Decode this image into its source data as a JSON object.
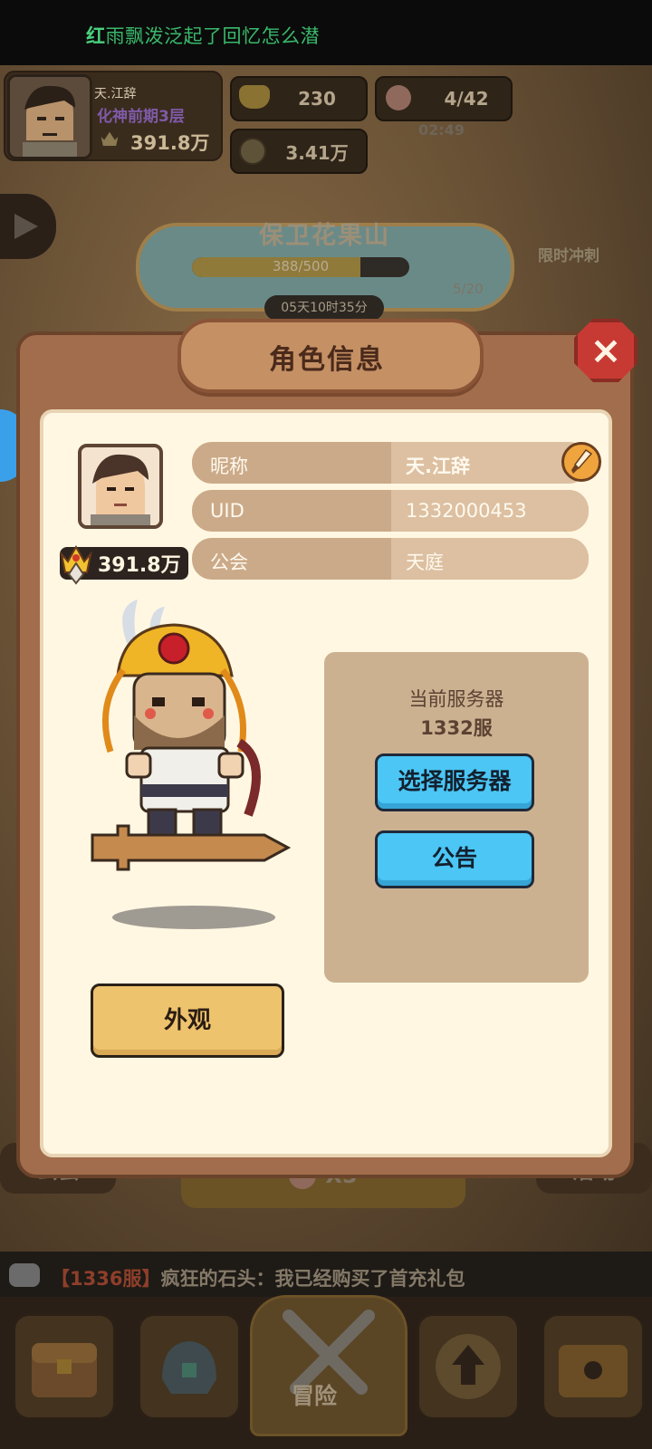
{
  "marquee": {
    "first_char": "红",
    "rest": "雨飘泼泛起了回忆怎么潜"
  },
  "player": {
    "name": "天.江辞",
    "rank": "化神前期3层",
    "power": "391.8万"
  },
  "resources": {
    "gold": "230",
    "peach_energy": "4/42",
    "energy_timer": "02:49",
    "coins": "3.41万"
  },
  "event": {
    "title": "保卫花果山",
    "progress_text": "388/500",
    "progress_ratio": 0.776,
    "reward_count": "5/20",
    "timer": "05天10时35分"
  },
  "side": {
    "limit_sprint": "限时冲刺"
  },
  "background_buttons": {
    "guild": "公会",
    "activity": "活动",
    "peach_multiplier": "X5"
  },
  "chat": {
    "server_tag": "【1336服】",
    "message": "疯狂的石头：我已经购买了首充礼包"
  },
  "nav": {
    "center_label": "冒险"
  },
  "modal": {
    "title": "角色信息",
    "close_icon": "×",
    "power": "391.8万",
    "rows": [
      {
        "label": "昵称",
        "value": "天.江辞"
      },
      {
        "label": "UID",
        "value": "1332000453"
      },
      {
        "label": "公会",
        "value": "天庭"
      }
    ],
    "server_label": "当前服务器",
    "server_value": "1332服",
    "select_server_button": "选择服务器",
    "notice_button": "公告",
    "appearance_button": "外观"
  },
  "colors": {
    "modal_frame": "#a26d4c",
    "modal_inner": "#fff7e2",
    "blue_button": "#4bc6f5",
    "yellow_button": "#eec36e",
    "close_red": "#c73a33"
  },
  "icons": [
    "gold-ingot-icon",
    "peach-icon",
    "coin-icon",
    "play-icon",
    "crown-power-icon",
    "brush-edit-icon",
    "close-icon",
    "chat-icon",
    "chest-icon",
    "helmet-icon",
    "crossed-swords-icon",
    "upgrade-arrow-icon",
    "locked-chest-icon"
  ]
}
